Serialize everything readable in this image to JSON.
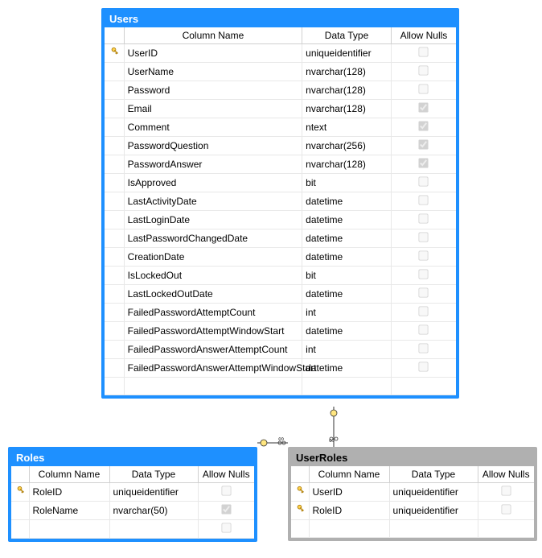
{
  "headers": {
    "colName": "Column Name",
    "dataType": "Data Type",
    "allowNulls": "Allow Nulls"
  },
  "tables": {
    "users": {
      "title": "Users",
      "columns": [
        {
          "key": true,
          "name": "UserID",
          "type": "uniqueidentifier",
          "allowNull": false
        },
        {
          "key": false,
          "name": "UserName",
          "type": "nvarchar(128)",
          "allowNull": false
        },
        {
          "key": false,
          "name": "Password",
          "type": "nvarchar(128)",
          "allowNull": false
        },
        {
          "key": false,
          "name": "Email",
          "type": "nvarchar(128)",
          "allowNull": true
        },
        {
          "key": false,
          "name": "Comment",
          "type": "ntext",
          "allowNull": true
        },
        {
          "key": false,
          "name": "PasswordQuestion",
          "type": "nvarchar(256)",
          "allowNull": true
        },
        {
          "key": false,
          "name": "PasswordAnswer",
          "type": "nvarchar(128)",
          "allowNull": true
        },
        {
          "key": false,
          "name": "IsApproved",
          "type": "bit",
          "allowNull": false
        },
        {
          "key": false,
          "name": "LastActivityDate",
          "type": "datetime",
          "allowNull": false
        },
        {
          "key": false,
          "name": "LastLoginDate",
          "type": "datetime",
          "allowNull": false
        },
        {
          "key": false,
          "name": "LastPasswordChangedDate",
          "type": "datetime",
          "allowNull": false
        },
        {
          "key": false,
          "name": "CreationDate",
          "type": "datetime",
          "allowNull": false
        },
        {
          "key": false,
          "name": "IsLockedOut",
          "type": "bit",
          "allowNull": false
        },
        {
          "key": false,
          "name": "LastLockedOutDate",
          "type": "datetime",
          "allowNull": false
        },
        {
          "key": false,
          "name": "FailedPasswordAttemptCount",
          "type": "int",
          "allowNull": false
        },
        {
          "key": false,
          "name": "FailedPasswordAttemptWindowStart",
          "type": "datetime",
          "allowNull": false
        },
        {
          "key": false,
          "name": "FailedPasswordAnswerAttemptCount",
          "type": "int",
          "allowNull": false
        },
        {
          "key": false,
          "name": "FailedPasswordAnswerAttemptWindowStart",
          "type": "datetime",
          "allowNull": false
        }
      ]
    },
    "roles": {
      "title": "Roles",
      "columns": [
        {
          "key": true,
          "name": "RoleID",
          "type": "uniqueidentifier",
          "allowNull": false
        },
        {
          "key": false,
          "name": "RoleName",
          "type": "nvarchar(50)",
          "allowNull": true
        }
      ]
    },
    "userroles": {
      "title": "UserRoles",
      "columns": [
        {
          "key": true,
          "name": "UserID",
          "type": "uniqueidentifier",
          "allowNull": false
        },
        {
          "key": true,
          "name": "RoleID",
          "type": "uniqueidentifier",
          "allowNull": false
        }
      ]
    }
  }
}
